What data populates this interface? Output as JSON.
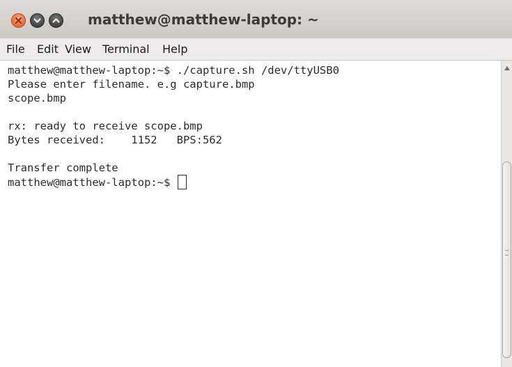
{
  "window": {
    "title": "matthew@matthew-laptop: ~"
  },
  "menu": {
    "file": "File",
    "edit": "Edit",
    "view": "View",
    "terminal": "Terminal",
    "help": "Help"
  },
  "terminal": {
    "lines": [
      "matthew@matthew-laptop:~$ ./capture.sh /dev/ttyUSB0",
      "Please enter filename. e.g capture.bmp",
      "scope.bmp",
      "",
      "rx: ready to receive scope.bmp",
      "Bytes received:    1152   BPS:562",
      "",
      "Transfer complete"
    ],
    "prompt": "matthew@matthew-laptop:~$ "
  }
}
